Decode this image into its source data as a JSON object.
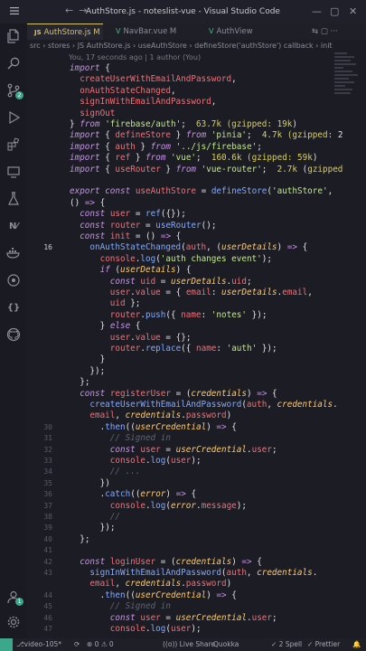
{
  "title": "AuthStore.js - noteslist-vue - Visual Studio Code",
  "tabs": [
    {
      "icon": "JS",
      "label": "AuthStore.js M"
    },
    {
      "icon": "V",
      "label": "NavBar.vue M"
    },
    {
      "icon": "V",
      "label": "AuthView"
    }
  ],
  "breadcrumb": [
    "src",
    "stores",
    "JS AuthStore.js",
    "useAuthStore",
    "defineStore('authStore') callback",
    "init"
  ],
  "blame": "You, 17 seconds ago | 1 author (You)",
  "code_lines": [
    {
      "n": "",
      "t": "import {"
    },
    {
      "n": "",
      "t": "  createUserWithEmailAndPassword,"
    },
    {
      "n": "",
      "t": "  onAuthStateChanged,"
    },
    {
      "n": "",
      "t": "  signInWithEmailAndPassword,"
    },
    {
      "n": "",
      "t": "  signOut"
    },
    {
      "n": "",
      "t": "} from 'firebase/auth';  63.7k (gzipped: 19k)"
    },
    {
      "n": "",
      "t": "import { defineStore } from 'pinia';  4.7k (gzipped: 2"
    },
    {
      "n": "",
      "t": "import { auth } from '../js/firebase';"
    },
    {
      "n": "",
      "t": "import { ref } from 'vue';  160.6k (gzipped: 59k)"
    },
    {
      "n": "",
      "t": "import { useRouter } from 'vue-router';  2.7k (gzipped"
    },
    {
      "n": "",
      "t": ""
    },
    {
      "n": "",
      "t": "export const useAuthStore = defineStore('authStore',"
    },
    {
      "n": "",
      "t": "() => {"
    },
    {
      "n": "",
      "t": "  const user = ref({});"
    },
    {
      "n": "",
      "t": "  const router = useRouter();"
    },
    {
      "n": "",
      "t": "  const init = () => {"
    },
    {
      "n": "16",
      "t": "    onAuthStateChanged(auth, (userDetails) => {"
    },
    {
      "n": "",
      "t": "      console.log('auth changes event');"
    },
    {
      "n": "",
      "t": "      if (userDetails) {"
    },
    {
      "n": "",
      "t": "        const uid = userDetails.uid;"
    },
    {
      "n": "",
      "t": "        user.value = { email: userDetails.email,"
    },
    {
      "n": "",
      "t": "        uid };"
    },
    {
      "n": "",
      "t": "        router.push({ name: 'notes' });"
    },
    {
      "n": "",
      "t": "      } else {"
    },
    {
      "n": "",
      "t": "        user.value = {};"
    },
    {
      "n": "",
      "t": "        router.replace({ name: 'auth' });"
    },
    {
      "n": "",
      "t": "      }"
    },
    {
      "n": "",
      "t": "    });"
    },
    {
      "n": "",
      "t": "  };"
    },
    {
      "n": "",
      "t": "  const registerUser = (credentials) => {"
    },
    {
      "n": "",
      "t": "    createUserWithEmailAndPassword(auth, credentials."
    },
    {
      "n": "",
      "t": "    email, credentials.password)"
    },
    {
      "n": "30",
      "t": "      .then((userCredential) => {"
    },
    {
      "n": "31",
      "t": "        // Signed in"
    },
    {
      "n": "32",
      "t": "        const user = userCredential.user;"
    },
    {
      "n": "33",
      "t": "        console.log(user);"
    },
    {
      "n": "34",
      "t": "        // ..."
    },
    {
      "n": "35",
      "t": "      })"
    },
    {
      "n": "36",
      "t": "      .catch((error) => {"
    },
    {
      "n": "37",
      "t": "        console.log(error.message);"
    },
    {
      "n": "38",
      "t": "        //"
    },
    {
      "n": "39",
      "t": "      });"
    },
    {
      "n": "40",
      "t": "  };"
    },
    {
      "n": "41",
      "t": ""
    },
    {
      "n": "42",
      "t": "  const loginUser = (credentials) => {"
    },
    {
      "n": "43",
      "t": "    signInWithEmailAndPassword(auth, credentials."
    },
    {
      "n": "",
      "t": "    email, credentials.password)"
    },
    {
      "n": "44",
      "t": "      .then((userCredential) => {"
    },
    {
      "n": "45",
      "t": "        // Signed in"
    },
    {
      "n": "46",
      "t": "        const user = userCredential.user;"
    },
    {
      "n": "47",
      "t": "        console.log(user);"
    }
  ],
  "statusbar": {
    "branch": "video-105*",
    "sync": "⟳",
    "errors": "⊗ 0 ⚠ 0",
    "live": "((o)) Live Share",
    "quokka": "Quokka",
    "spell": "✓ 2 Spell",
    "prettier": "✓ Prettier",
    "bell": "🔔"
  },
  "icons": [
    "menu-icon",
    "explorer-icon",
    "search-icon",
    "source-control-icon",
    "run-debug-icon",
    "extensions-icon",
    "remote-explorer-icon",
    "testing-icon",
    "nx-console-icon",
    "docker-icon",
    "git-graph-icon",
    "json-icon",
    "github-icon",
    "accounts-icon",
    "settings-icon"
  ],
  "accent_color": "#d9c36a"
}
